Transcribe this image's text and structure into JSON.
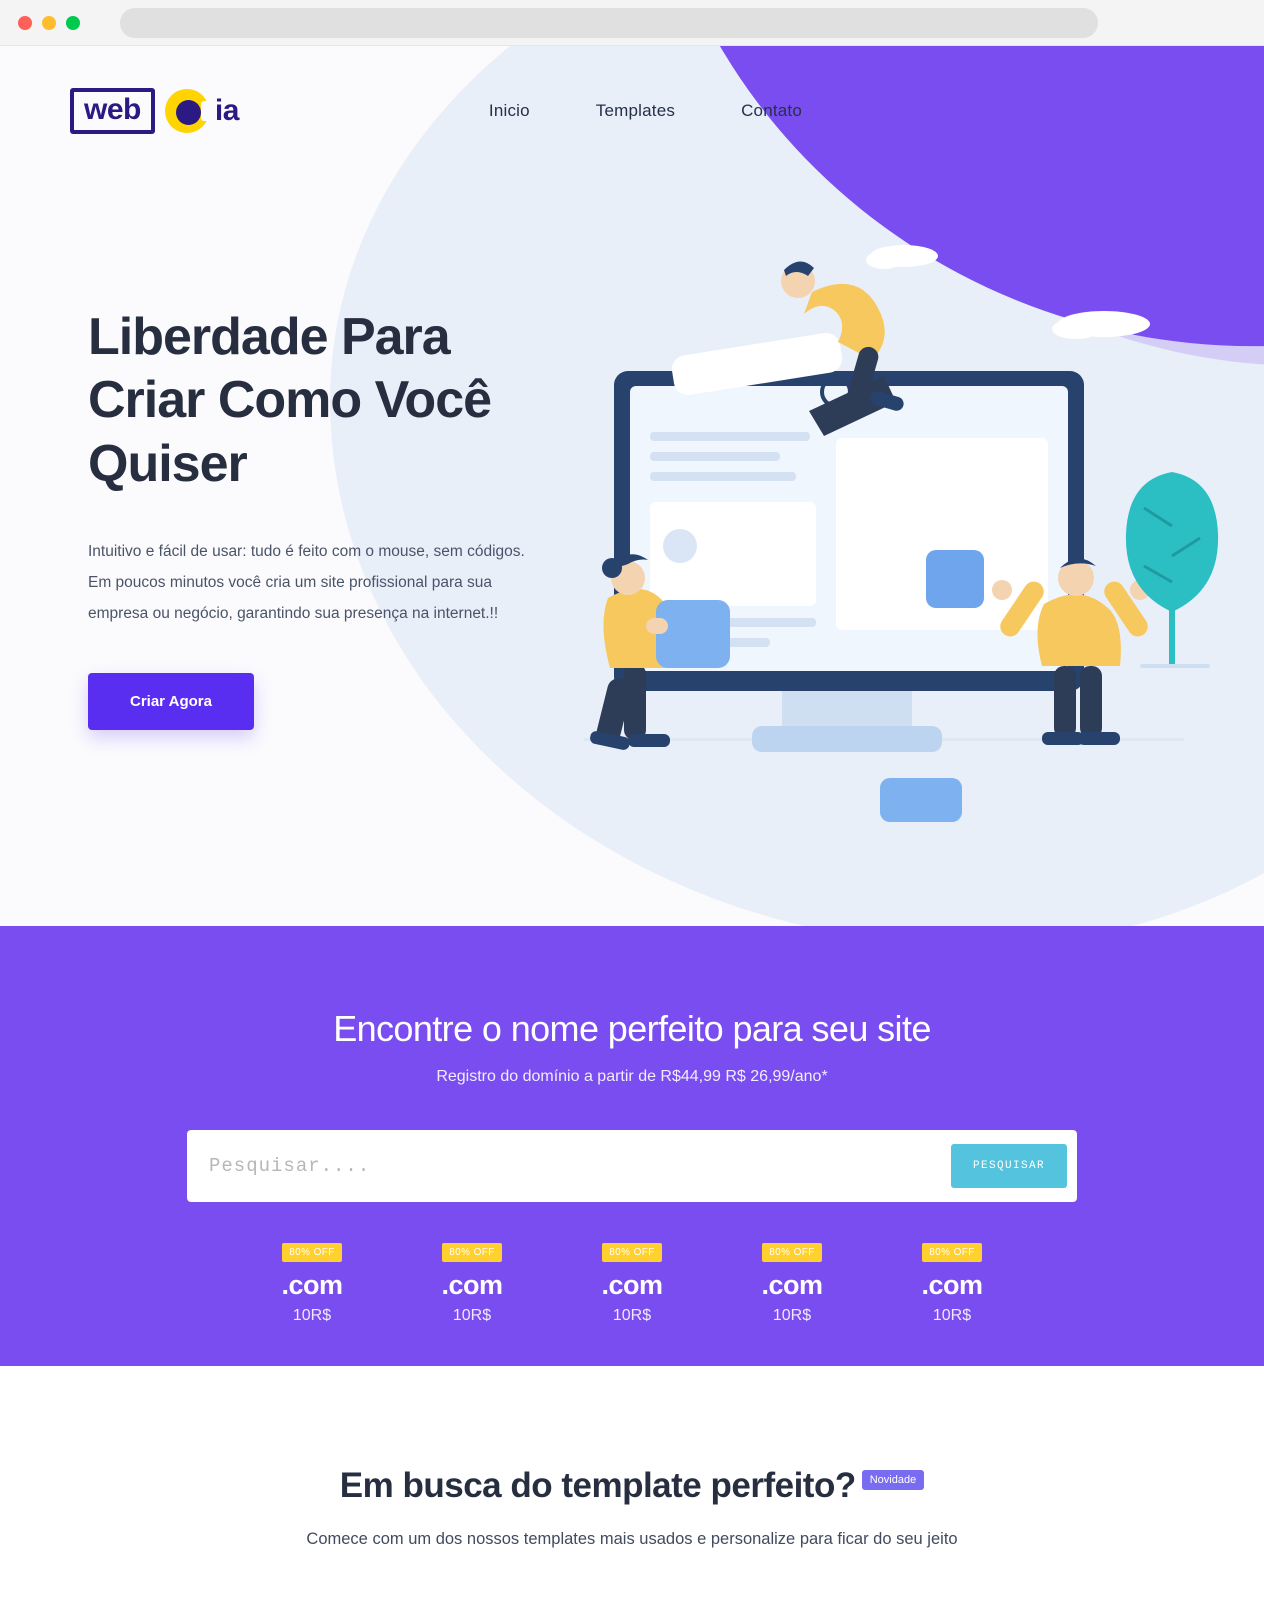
{
  "browser": {
    "traffic_lights": [
      "close",
      "minimize",
      "maximize"
    ],
    "url_value": ""
  },
  "header": {
    "logo": {
      "word": "web",
      "suffix": "ia"
    },
    "nav": [
      {
        "label": "Inicio"
      },
      {
        "label": "Templates"
      },
      {
        "label": "Contato"
      }
    ]
  },
  "hero": {
    "title": "Liberdade Para Criar Como Você Quiser",
    "paragraph": "Intuitivo e fácil de usar: tudo é feito com o mouse, sem códigos. Em poucos minutos você cria um site profissional para sua empresa ou negócio, garantindo sua presença na internet.!!",
    "cta_label": "Criar Agora"
  },
  "domain": {
    "title": "Encontre o nome perfeito para seu site",
    "subtitle": "Registro do domínio a partir de R$44,99 R$ 26,99/ano*",
    "search_placeholder": "Pesquisar....",
    "search_value": "",
    "search_button": "PESQUISAR",
    "tlds": [
      {
        "badge": "80% OFF",
        "name": ".com",
        "price": "10R$"
      },
      {
        "badge": "80% OFF",
        "name": ".com",
        "price": "10R$"
      },
      {
        "badge": "80% OFF",
        "name": ".com",
        "price": "10R$"
      },
      {
        "badge": "80% OFF",
        "name": ".com",
        "price": "10R$"
      },
      {
        "badge": "80% OFF",
        "name": ".com",
        "price": "10R$"
      }
    ]
  },
  "templates": {
    "title": "Em busca do template perfeito?",
    "badge": "Novidade",
    "subtitle": "Comece com um dos nossos templates mais usados e personalize para ficar do seu jeito"
  },
  "colors": {
    "purple": "#7a4df0",
    "purple_dark": "#5a2ef0",
    "logo_navy": "#2b1a83",
    "logo_yellow": "#ffd400",
    "badge_yellow": "#ffd02e",
    "teal": "#54c3dd",
    "heading": "#262e40"
  }
}
